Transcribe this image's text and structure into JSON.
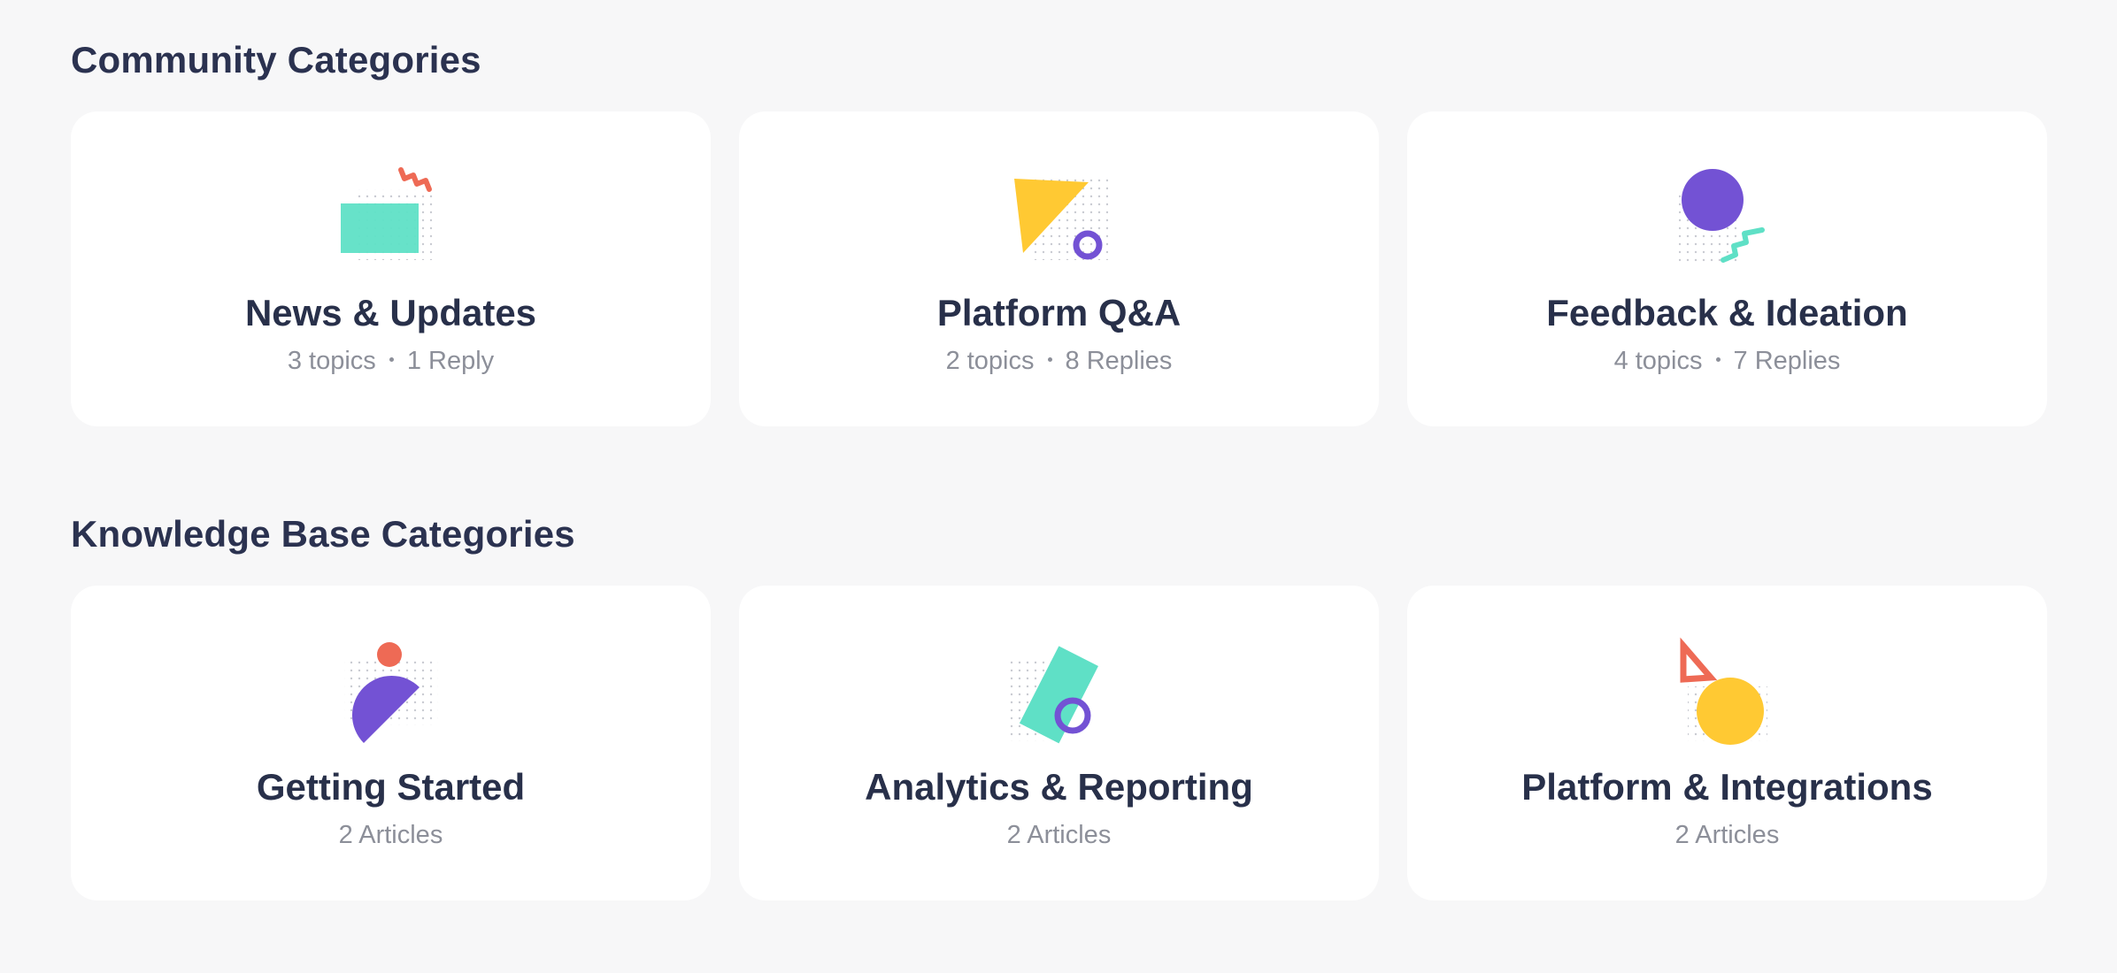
{
  "sections": {
    "community": {
      "title": "Community Categories",
      "cards": [
        {
          "title": "News & Updates",
          "topics": "3 topics",
          "replies": "1 Reply",
          "icon": "rectangle-zigzag-icon"
        },
        {
          "title": "Platform Q&A",
          "topics": "2 topics",
          "replies": "8 Replies",
          "icon": "triangle-ring-icon"
        },
        {
          "title": "Feedback & Ideation",
          "topics": "4 topics",
          "replies": "7 Replies",
          "icon": "circle-zigzag-icon"
        }
      ]
    },
    "knowledge_base": {
      "title": "Knowledge Base Categories",
      "cards": [
        {
          "title": "Getting Started",
          "count": "2 Articles",
          "icon": "dot-halfcircle-icon"
        },
        {
          "title": "Analytics & Reporting",
          "count": "2 Articles",
          "icon": "rectangle-ring-icon"
        },
        {
          "title": "Platform & Integrations",
          "count": "2 Articles",
          "icon": "triangle-circle-icon"
        }
      ]
    }
  },
  "colors": {
    "background": "#f7f7f8",
    "card": "#ffffff",
    "title": "#28304a",
    "meta": "#8c8f99",
    "teal": "#5fe0c6",
    "coral": "#ee6a55",
    "yellow": "#ffc933",
    "purple": "#7352d4",
    "dots": "#c9cbd2"
  }
}
